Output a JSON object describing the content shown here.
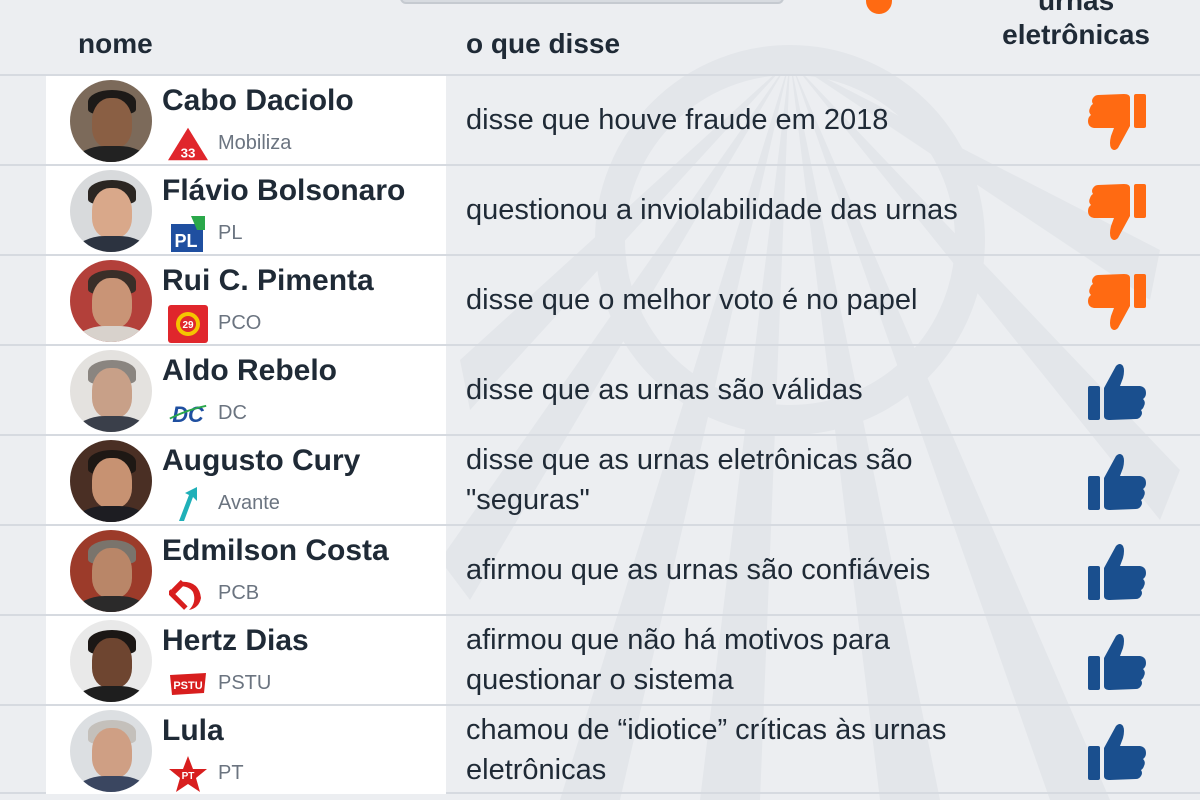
{
  "header": {
    "col_name": "nome",
    "col_said": "o que disse",
    "col_urnas_line1": "urnas",
    "col_urnas_line2": "eletrônicas"
  },
  "colors": {
    "against": "#ff6a12",
    "favor": "#1a4f8e",
    "background": "#eceef1"
  },
  "rows": [
    {
      "name": "Cabo Daciolo",
      "party": "Mobiliza",
      "party_icon": "mobiliza-33-triangle-icon",
      "statement": "disse que houve fraude em 2018",
      "stance": "against"
    },
    {
      "name": "Flávio Bolsonaro",
      "party": "PL",
      "party_icon": "pl-logo-icon",
      "statement": "questionou a inviolabilidade das urnas",
      "stance": "against"
    },
    {
      "name": "Rui C. Pimenta",
      "party": "PCO",
      "party_icon": "pco-29-gear-icon",
      "statement": "disse que o melhor voto é no papel",
      "stance": "against"
    },
    {
      "name": "Aldo Rebelo",
      "party": "DC",
      "party_icon": "dc-logo-icon",
      "statement": "disse que as urnas são válidas",
      "stance": "favor"
    },
    {
      "name": "Augusto Cury",
      "party": "Avante",
      "party_icon": "avante-arrow-icon",
      "statement": "disse que as urnas eletrônicas são \"seguras\"",
      "stance": "favor"
    },
    {
      "name": "Edmilson Costa",
      "party": "PCB",
      "party_icon": "hammer-sickle-icon",
      "statement": "afirmou que as urnas são confiáveis",
      "stance": "favor"
    },
    {
      "name": "Hertz Dias",
      "party": "PSTU",
      "party_icon": "pstu-logo-icon",
      "statement": "afirmou que não há motivos para questionar o sistema",
      "stance": "favor"
    },
    {
      "name": "Lula",
      "party": "PT",
      "party_icon": "pt-star-icon",
      "statement": "chamou de “idiotice” críticas às urnas eletrônicas",
      "stance": "favor"
    }
  ]
}
